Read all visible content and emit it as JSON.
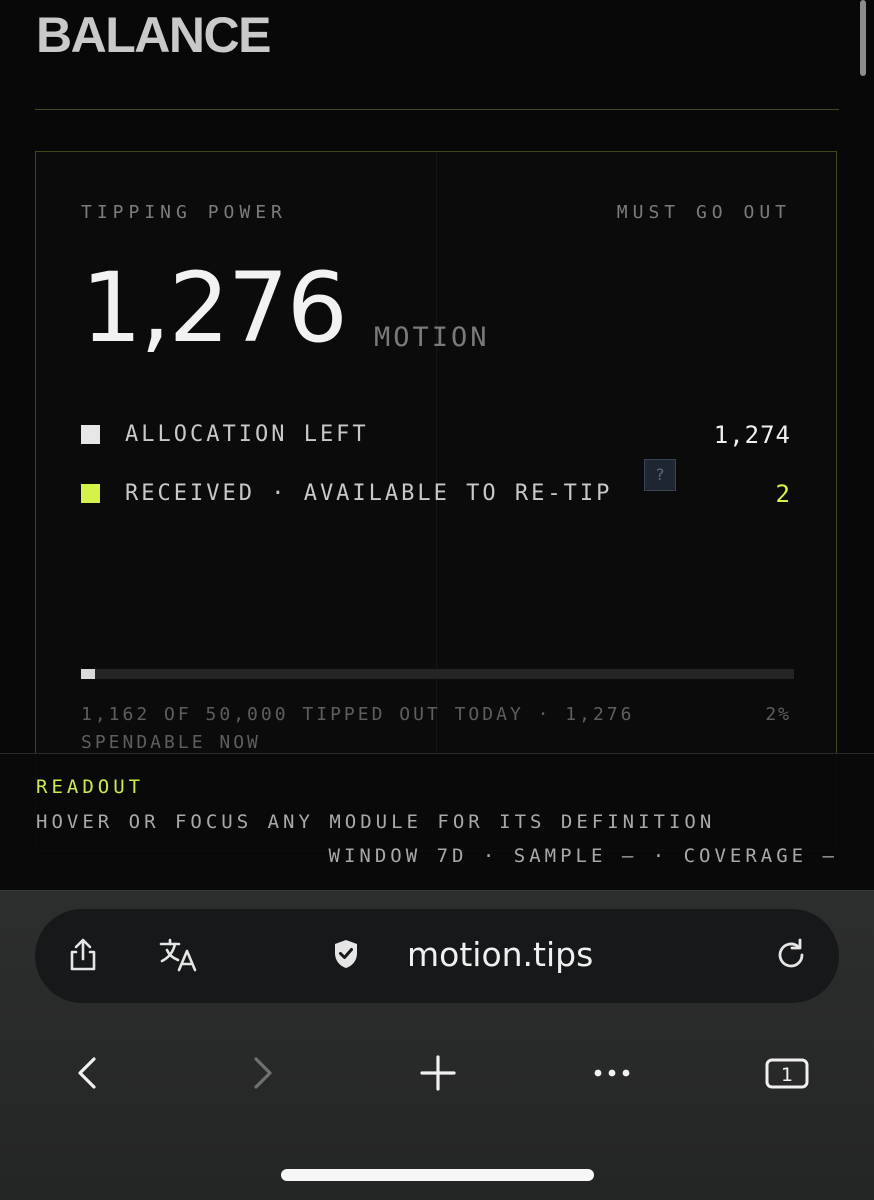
{
  "page": {
    "title": "BALANCE"
  },
  "card": {
    "left_label": "TIPPING POWER",
    "right_label": "MUST GO OUT",
    "total": "1,276",
    "unit": "MOTION",
    "rows": [
      {
        "label": "ALLOCATION LEFT",
        "value": "1,274",
        "color": "#e6e6e6"
      },
      {
        "label": "RECEIVED · AVAILABLE TO RE-TIP",
        "value": "2",
        "color": "#d4f34a"
      }
    ],
    "help_glyph": "?",
    "progress": {
      "fraction": 0.02
    },
    "footer_text": "1,162 OF 50,000 TIPPED OUT TODAY · 1,276 SPENDABLE NOW",
    "footer_pct": "2%"
  },
  "readout": {
    "title": "READOUT",
    "description": "HOVER OR FOCUS ANY MODULE FOR ITS DEFINITION",
    "meta": "WINDOW 7D · SAMPLE — · COVERAGE —"
  },
  "browser": {
    "url": "motion.tips",
    "icons": [
      "share-icon",
      "translate-icon",
      "shield-check-icon",
      "reload-icon",
      "back-icon",
      "forward-icon",
      "plus-icon",
      "more-icon",
      "tabs-icon"
    ],
    "tab_count": "1"
  },
  "colors": {
    "accent": "#c9ec4d",
    "background": "#080808"
  }
}
